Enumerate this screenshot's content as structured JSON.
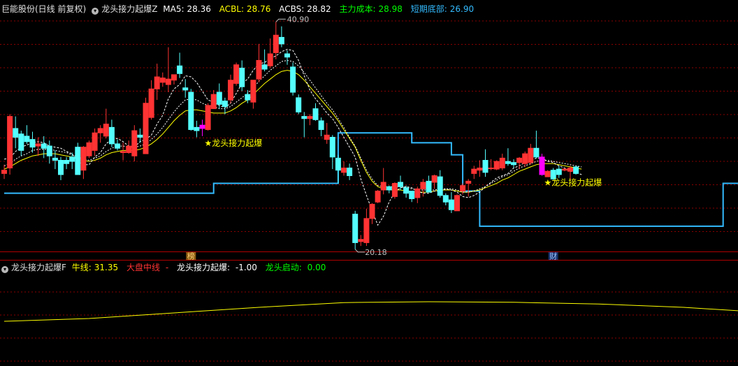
{
  "main_header": {
    "stock": "巨能股份(日线 前复权)",
    "indicator": "龙头接力起爆Z",
    "items": [
      {
        "label": "MA5:",
        "value": "28.36",
        "color": "#ffffff"
      },
      {
        "label": "ACBL:",
        "value": "28.76",
        "color": "#ffff00"
      },
      {
        "label": "ACBS:",
        "value": "28.82",
        "color": "#ffffff"
      },
      {
        "label": "主力成本:",
        "value": "28.98",
        "color": "#00ff00"
      },
      {
        "label": "短期底部:",
        "value": "26.90",
        "color": "#33bbff"
      }
    ]
  },
  "sub_header": {
    "indicator": "龙头接力起爆F",
    "items": [
      {
        "label": "牛线:",
        "value": "31.35",
        "color": "#ffff00"
      },
      {
        "label": "大盘中线",
        "value": "-",
        "color": "#ff3333"
      },
      {
        "label": "龙头接力起爆:",
        "value": "-1.00",
        "color": "#ffffff"
      },
      {
        "label": "龙头启动:",
        "value": "0.00",
        "color": "#00ff00"
      }
    ]
  },
  "colors": {
    "up": "#ff3333",
    "down": "#54ffff",
    "signal": "#ff00ff",
    "bottom_line": "#33bbff",
    "ma_line": "#ffffff",
    "acbl_line": "#ffff00",
    "grid": "#8b0000",
    "separator": "#b00000"
  },
  "chart_data": [
    {
      "type": "candlestick",
      "ylim": [
        20,
        41.5
      ],
      "candles": [
        [
          27.1,
          27.9,
          26.6,
          27.4
        ],
        [
          27.6,
          32.5,
          27.0,
          32.3
        ],
        [
          31.2,
          32.3,
          29.4,
          30.4
        ],
        [
          30.7,
          31.0,
          28.7,
          29.2
        ],
        [
          30.5,
          31.5,
          29.8,
          30.0
        ],
        [
          30.2,
          30.9,
          29.0,
          29.5
        ],
        [
          29.6,
          30.4,
          28.7,
          29.8
        ],
        [
          29.8,
          30.5,
          28.5,
          29.4
        ],
        [
          29.6,
          30.1,
          28.0,
          28.7
        ],
        [
          28.5,
          29.2,
          27.5,
          28.3
        ],
        [
          28.3,
          28.6,
          26.5,
          27.0
        ],
        [
          28.3,
          28.6,
          27.5,
          28.0
        ],
        [
          28.6,
          29.0,
          27.5,
          28.2
        ],
        [
          29.5,
          29.9,
          27.0,
          27.0
        ],
        [
          27.4,
          29.6,
          26.6,
          29.5
        ],
        [
          28.7,
          30.1,
          28.5,
          29.9
        ],
        [
          29.2,
          31.2,
          28.7,
          30.8
        ],
        [
          30.8,
          31.5,
          29.9,
          31.2
        ],
        [
          30.5,
          33.0,
          30.3,
          31.6
        ],
        [
          31.3,
          32.0,
          29.5,
          29.8
        ],
        [
          29.8,
          30.2,
          29.2,
          29.4
        ],
        [
          29.0,
          29.9,
          28.3,
          29.1
        ],
        [
          29.0,
          30.1,
          28.9,
          29.6
        ],
        [
          28.7,
          31.5,
          28.2,
          31.0
        ],
        [
          30.6,
          31.2,
          29.9,
          30.4
        ],
        [
          28.9,
          34.0,
          29.0,
          33.5
        ],
        [
          32.2,
          35.6,
          32.0,
          34.8
        ],
        [
          34.8,
          37.1,
          33.8,
          35.9
        ],
        [
          35.4,
          36.3,
          35.0,
          35.8
        ],
        [
          35.2,
          38.6,
          34.5,
          35.7
        ],
        [
          35.6,
          36.1,
          35.2,
          36.1
        ],
        [
          36.9,
          38.1,
          35.8,
          36.2
        ],
        [
          34.9,
          35.7,
          34.0,
          34.7
        ],
        [
          34.5,
          34.8,
          31.0,
          31.1
        ],
        [
          31.3,
          31.9,
          30.4,
          31.0
        ],
        [
          31.2,
          32.0,
          30.5,
          31.5
        ],
        [
          31.1,
          33.5,
          31.0,
          33.3
        ],
        [
          33.0,
          34.7,
          33.0,
          34.3
        ],
        [
          34.5,
          35.3,
          33.0,
          33.4
        ],
        [
          33.7,
          34.0,
          32.5,
          33.2
        ],
        [
          33.8,
          36.1,
          33.5,
          35.6
        ],
        [
          35.3,
          37.2,
          35.1,
          37.0
        ],
        [
          36.7,
          37.4,
          34.6,
          35.0
        ],
        [
          34.3,
          34.7,
          33.5,
          33.8
        ],
        [
          33.6,
          35.6,
          33.0,
          35.6
        ],
        [
          35.7,
          38.9,
          35.4,
          37.4
        ],
        [
          37.0,
          38.4,
          36.4,
          36.6
        ],
        [
          36.9,
          39.4,
          36.7,
          38.0
        ],
        [
          38.1,
          40.9,
          37.5,
          39.7
        ],
        [
          39.5,
          40.5,
          38.6,
          38.9
        ],
        [
          38.0,
          38.3,
          37.0,
          37.7
        ],
        [
          36.8,
          37.2,
          34.2,
          34.5
        ],
        [
          34.0,
          34.3,
          32.5,
          32.7
        ],
        [
          32.3,
          32.7,
          30.4,
          32.1
        ],
        [
          32.1,
          32.5,
          31.5,
          32.3
        ],
        [
          33.0,
          33.5,
          31.9,
          32.0
        ],
        [
          31.9,
          32.2,
          30.5,
          31.1
        ],
        [
          30.2,
          31.7,
          29.8,
          30.6
        ],
        [
          30.4,
          30.6,
          27.5,
          28.6
        ],
        [
          28.5,
          28.8,
          26.2,
          27.4
        ],
        [
          27.2,
          28.2,
          26.9,
          27.6
        ],
        [
          27.6,
          28.0,
          26.5,
          26.9
        ],
        [
          23.4,
          23.7,
          20.2,
          20.8
        ],
        [
          20.9,
          21.5,
          20.5,
          21.1
        ],
        [
          20.8,
          23.9,
          20.5,
          23.0
        ],
        [
          23.0,
          24.4,
          22.5,
          24.3
        ],
        [
          24.5,
          25.6,
          24.4,
          25.5
        ],
        [
          25.6,
          27.6,
          25.2,
          26.3
        ],
        [
          25.9,
          26.0,
          25.3,
          25.6
        ],
        [
          25.0,
          26.3,
          24.8,
          26.2
        ],
        [
          26.3,
          26.9,
          25.6,
          25.9
        ],
        [
          25.8,
          26.0,
          24.9,
          25.3
        ],
        [
          25.5,
          25.5,
          24.5,
          24.8
        ],
        [
          24.9,
          25.9,
          24.4,
          25.7
        ],
        [
          25.7,
          26.6,
          25.0,
          26.3
        ],
        [
          26.4,
          26.9,
          25.4,
          25.4
        ],
        [
          26.3,
          27.0,
          25.7,
          26.9
        ],
        [
          26.8,
          27.4,
          24.9,
          25.1
        ],
        [
          25.1,
          25.3,
          24.2,
          24.5
        ],
        [
          24.7,
          25.4,
          23.5,
          23.8
        ],
        [
          23.7,
          25.2,
          23.8,
          25.1
        ],
        [
          25.5,
          26.2,
          25.2,
          26.0
        ],
        [
          26.2,
          26.6,
          25.0,
          26.4
        ],
        [
          27.1,
          27.8,
          26.6,
          27.5
        ],
        [
          27.4,
          28.3,
          26.8,
          27.6
        ],
        [
          28.3,
          29.3,
          26.8,
          27.2
        ],
        [
          27.6,
          28.4,
          27.4,
          27.6
        ],
        [
          27.5,
          28.3,
          27.4,
          28.2
        ],
        [
          27.6,
          28.9,
          27.4,
          28.5
        ],
        [
          28.2,
          29.4,
          27.8,
          28.0
        ],
        [
          28.1,
          28.4,
          27.6,
          27.9
        ],
        [
          28.1,
          28.6,
          27.5,
          28.5
        ],
        [
          28.0,
          29.1,
          27.7,
          28.9
        ],
        [
          28.1,
          29.8,
          27.9,
          29.4
        ],
        [
          29.4,
          31.0,
          28.5,
          28.6
        ],
        [
          28.6,
          28.9,
          26.9,
          27.0
        ],
        [
          26.8,
          27.4,
          27.0,
          27.3
        ],
        [
          27.4,
          27.6,
          26.5,
          26.6
        ],
        [
          27.5,
          27.8,
          26.7,
          27.0
        ],
        [
          27.4,
          27.6,
          27.3,
          27.5
        ],
        [
          27.3,
          27.8,
          26.5,
          27.6
        ],
        [
          27.7,
          27.8,
          27.0,
          27.1
        ]
      ],
      "ma5": [
        28.4,
        28.5,
        29.1,
        29.5,
        29.7,
        29.9,
        30.0,
        29.9,
        29.6,
        29.5,
        29.4,
        29.1,
        28.9,
        28.2,
        27.9,
        27.9,
        28.6,
        29.0,
        29.8,
        30.2,
        30.3,
        30.0,
        29.6,
        29.5,
        30.0,
        30.2,
        30.6,
        31.6,
        32.4,
        33.9,
        34.8,
        35.2,
        36.0,
        35.9,
        35.4,
        34.6,
        33.8,
        33.6,
        33.3,
        33.1,
        33.5,
        34.4,
        35.3,
        35.7,
        36.5,
        37.1,
        37.2,
        37.6,
        37.8,
        38.2,
        38.4,
        38.3,
        37.4,
        36.0,
        34.7,
        33.9,
        33.3,
        32.6,
        32.1,
        31.3,
        30.4,
        29.5,
        28.6,
        26.6,
        25.1,
        23.7,
        22.4,
        23.2,
        24.5,
        25.4,
        25.8,
        25.9,
        25.8,
        25.5,
        25.3,
        25.3,
        25.5,
        25.5,
        25.7,
        25.6,
        25.4,
        25.0,
        24.9,
        25.1,
        25.4,
        25.9,
        26.3,
        26.7,
        26.9,
        27.1,
        27.6,
        27.8,
        28.1,
        28.3,
        28.5,
        28.5,
        28.2,
        28.1,
        27.8,
        27.6,
        27.3,
        27.2,
        27.0
      ],
      "acbl": [
        27.5,
        27.7,
        28.0,
        28.3,
        28.5,
        28.7,
        28.8,
        28.9,
        28.9,
        28.9,
        28.8,
        28.7,
        28.6,
        28.4,
        28.3,
        28.2,
        28.3,
        28.5,
        28.8,
        29.0,
        29.1,
        29.2,
        29.2,
        29.2,
        29.3,
        29.5,
        29.8,
        30.2,
        30.7,
        31.3,
        31.9,
        32.4,
        32.8,
        32.9,
        32.9,
        32.8,
        32.7,
        32.6,
        32.6,
        32.6,
        32.8,
        33.1,
        33.5,
        33.8,
        34.3,
        34.8,
        35.3,
        35.7,
        36.1,
        36.4,
        36.5,
        36.4,
        36.1,
        35.6,
        35.0,
        34.4,
        33.8,
        33.2,
        32.6,
        31.9,
        31.1,
        30.3,
        29.5,
        28.3,
        27.2,
        26.4,
        25.9,
        25.7,
        25.6,
        25.6,
        25.6,
        25.5,
        25.4,
        25.4,
        25.4,
        25.4,
        25.5,
        25.6,
        25.6,
        25.6,
        25.5,
        25.4,
        25.4,
        25.5,
        25.6,
        25.8,
        26.0,
        26.2,
        26.5,
        26.7,
        27.0,
        27.3,
        27.5,
        27.7,
        27.9,
        28.0,
        28.0,
        28.0,
        27.9,
        27.8,
        27.7,
        27.6,
        27.5
      ],
      "acbs": [
        27.8,
        28.0,
        28.4,
        28.7,
        28.9,
        29.2,
        29.3,
        29.3,
        29.3,
        29.2,
        29.1,
        29.0,
        28.8,
        28.6,
        28.4,
        28.3,
        28.5,
        28.7,
        29.1,
        29.4,
        29.6,
        29.6,
        29.5,
        29.5,
        29.6,
        29.8,
        30.2,
        30.7,
        31.3,
        32.0,
        32.7,
        33.3,
        33.8,
        33.9,
        33.8,
        33.5,
        33.3,
        33.2,
        33.0,
        33.0,
        33.2,
        33.6,
        34.0,
        34.4,
        34.9,
        35.5,
        36.0,
        36.5,
        36.9,
        37.3,
        37.4,
        37.3,
        36.9,
        36.3,
        35.6,
        34.9,
        34.2,
        33.5,
        32.9,
        32.1,
        31.3,
        30.4,
        29.6,
        28.5,
        27.4,
        26.6,
        26.0,
        25.9,
        25.9,
        25.9,
        25.9,
        25.8,
        25.7,
        25.6,
        25.6,
        25.6,
        25.6,
        25.7,
        25.7,
        25.7,
        25.6,
        25.4,
        25.4,
        25.5,
        25.7,
        25.9,
        26.2,
        26.5,
        26.8,
        27.0,
        27.3,
        27.6,
        27.8,
        28.0,
        28.2,
        28.3,
        28.3,
        28.2,
        28.1,
        28.0,
        27.9,
        27.8,
        27.7
      ],
      "bottom_line_steps": [
        {
          "from": 0,
          "to": 36,
          "value": 25.3
        },
        {
          "from": 37,
          "to": 58,
          "value": 26.2
        },
        {
          "from": 59,
          "to": 71,
          "value": 30.8
        },
        {
          "from": 72,
          "to": 78,
          "value": 29.9
        },
        {
          "from": 79,
          "to": 80,
          "value": 28.8
        },
        {
          "from": 81,
          "to": 83,
          "value": 25.5
        },
        {
          "from": 84,
          "to": 126,
          "value": 22.3
        },
        {
          "from": 127,
          "to": 131,
          "value": 26.2
        }
      ],
      "signals": [
        {
          "index": 35,
          "label": "★龙头接力起爆"
        },
        {
          "index": 95,
          "label": "★龙头接力起爆"
        }
      ],
      "annotations": {
        "high": "40.90",
        "low": "20.18"
      },
      "markers": [
        {
          "index": 33,
          "label": "榜"
        },
        {
          "index": 97,
          "label": "财"
        }
      ]
    },
    {
      "type": "line",
      "series": [
        {
          "name": "牛线",
          "color": "#ffff00"
        }
      ],
      "points": [
        [
          0,
          0.3
        ],
        [
          15,
          0.4
        ],
        [
          30,
          0.6
        ],
        [
          45,
          0.8
        ],
        [
          60,
          0.97
        ],
        [
          75,
          1.0
        ],
        [
          90,
          0.98
        ],
        [
          105,
          0.92
        ],
        [
          120,
          0.8
        ],
        [
          131,
          0.66
        ]
      ]
    }
  ]
}
